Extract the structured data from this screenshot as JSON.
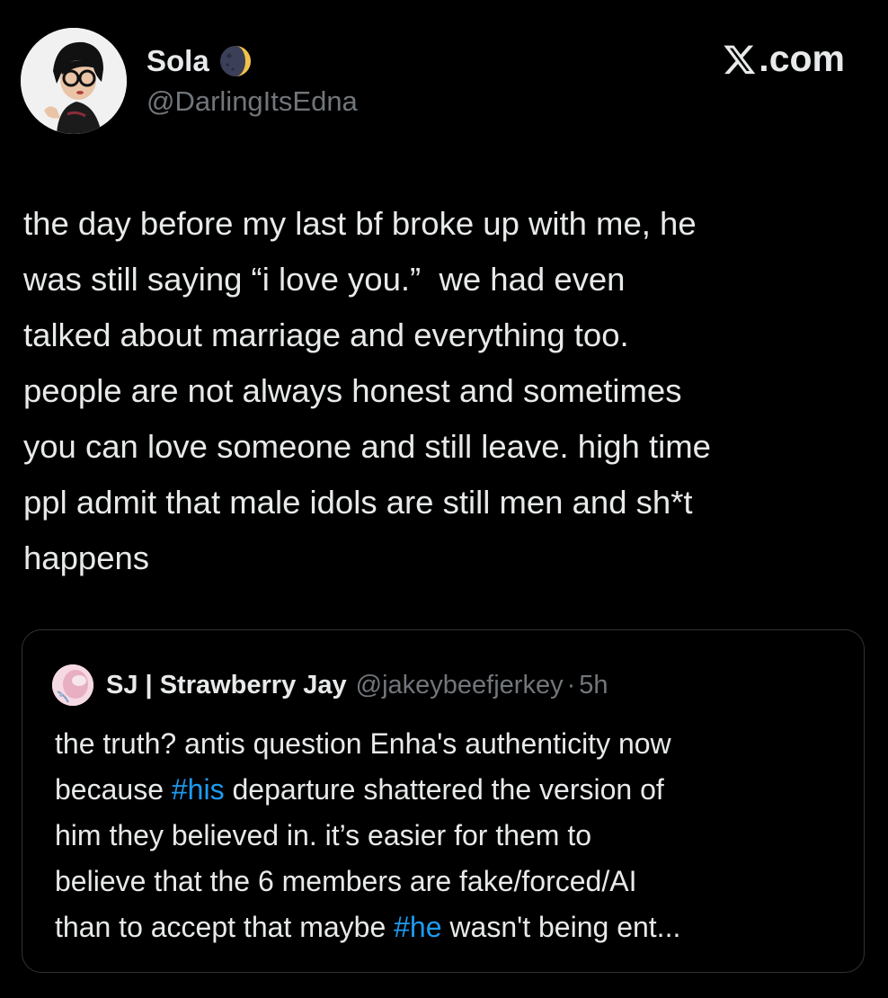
{
  "post": {
    "author": {
      "display_name": "Sola",
      "handle": "@DarlingItsEdna",
      "badge_icon": "crescent-moon-emoji"
    },
    "site_mark": {
      "icon": "x-logo-icon",
      "text": ".com"
    },
    "text_lines": [
      "the day before my last bf broke up with me, he",
      "was still saying “i love you.”  we had even",
      "talked about marriage and everything too.",
      "people are not always honest and sometimes",
      "you can love someone and still leave. high time",
      "ppl admit that male idols are still men and sh*t",
      "happens"
    ]
  },
  "quoted_post": {
    "author": {
      "display_name": "SJ | Strawberry Jay",
      "handle": "@jakeybeefjerkey",
      "separator": "·",
      "time": "5h"
    },
    "lines": [
      {
        "before": "the truth? antis question Enha's authenticity now",
        "tag": "",
        "after": ""
      },
      {
        "before": "because ",
        "tag": "#his",
        "after": " departure shattered the version of"
      },
      {
        "before": "him they believed in. it’s easier for them to",
        "tag": "",
        "after": ""
      },
      {
        "before": "believe that the 6 members are fake/forced/AI",
        "tag": "",
        "after": ""
      },
      {
        "before": "than to accept that maybe ",
        "tag": "#he",
        "after": " wasn't being ent..."
      }
    ]
  },
  "colors": {
    "background": "#000000",
    "text": "#e7e9ea",
    "secondary_text": "#71767b",
    "hashtag": "#1d9bf0",
    "card_border": "#2f3336"
  }
}
